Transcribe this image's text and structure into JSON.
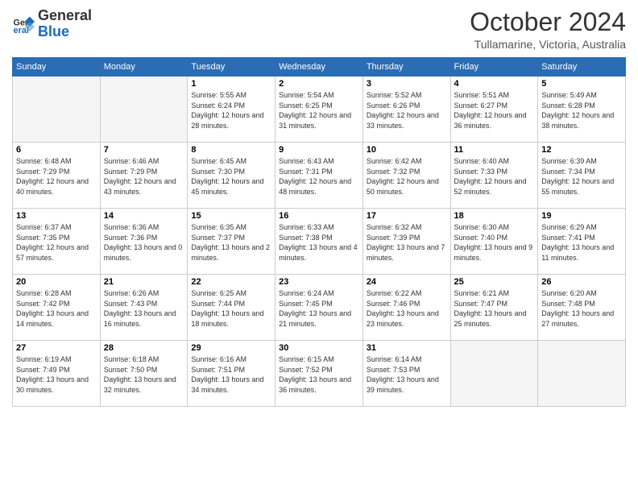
{
  "header": {
    "logo_general": "General",
    "logo_blue": "Blue",
    "month_title": "October 2024",
    "location": "Tullamarine, Victoria, Australia"
  },
  "days_of_week": [
    "Sunday",
    "Monday",
    "Tuesday",
    "Wednesday",
    "Thursday",
    "Friday",
    "Saturday"
  ],
  "weeks": [
    [
      {
        "day": "",
        "empty": true
      },
      {
        "day": "",
        "empty": true
      },
      {
        "day": "1",
        "sunrise": "5:55 AM",
        "sunset": "6:24 PM",
        "daylight": "12 hours and 28 minutes."
      },
      {
        "day": "2",
        "sunrise": "5:54 AM",
        "sunset": "6:25 PM",
        "daylight": "12 hours and 31 minutes."
      },
      {
        "day": "3",
        "sunrise": "5:52 AM",
        "sunset": "6:26 PM",
        "daylight": "12 hours and 33 minutes."
      },
      {
        "day": "4",
        "sunrise": "5:51 AM",
        "sunset": "6:27 PM",
        "daylight": "12 hours and 36 minutes."
      },
      {
        "day": "5",
        "sunrise": "5:49 AM",
        "sunset": "6:28 PM",
        "daylight": "12 hours and 38 minutes."
      }
    ],
    [
      {
        "day": "6",
        "sunrise": "6:48 AM",
        "sunset": "7:29 PM",
        "daylight": "12 hours and 40 minutes."
      },
      {
        "day": "7",
        "sunrise": "6:46 AM",
        "sunset": "7:29 PM",
        "daylight": "12 hours and 43 minutes."
      },
      {
        "day": "8",
        "sunrise": "6:45 AM",
        "sunset": "7:30 PM",
        "daylight": "12 hours and 45 minutes."
      },
      {
        "day": "9",
        "sunrise": "6:43 AM",
        "sunset": "7:31 PM",
        "daylight": "12 hours and 48 minutes."
      },
      {
        "day": "10",
        "sunrise": "6:42 AM",
        "sunset": "7:32 PM",
        "daylight": "12 hours and 50 minutes."
      },
      {
        "day": "11",
        "sunrise": "6:40 AM",
        "sunset": "7:33 PM",
        "daylight": "12 hours and 52 minutes."
      },
      {
        "day": "12",
        "sunrise": "6:39 AM",
        "sunset": "7:34 PM",
        "daylight": "12 hours and 55 minutes."
      }
    ],
    [
      {
        "day": "13",
        "sunrise": "6:37 AM",
        "sunset": "7:35 PM",
        "daylight": "12 hours and 57 minutes."
      },
      {
        "day": "14",
        "sunrise": "6:36 AM",
        "sunset": "7:36 PM",
        "daylight": "13 hours and 0 minutes."
      },
      {
        "day": "15",
        "sunrise": "6:35 AM",
        "sunset": "7:37 PM",
        "daylight": "13 hours and 2 minutes."
      },
      {
        "day": "16",
        "sunrise": "6:33 AM",
        "sunset": "7:38 PM",
        "daylight": "13 hours and 4 minutes."
      },
      {
        "day": "17",
        "sunrise": "6:32 AM",
        "sunset": "7:39 PM",
        "daylight": "13 hours and 7 minutes."
      },
      {
        "day": "18",
        "sunrise": "6:30 AM",
        "sunset": "7:40 PM",
        "daylight": "13 hours and 9 minutes."
      },
      {
        "day": "19",
        "sunrise": "6:29 AM",
        "sunset": "7:41 PM",
        "daylight": "13 hours and 11 minutes."
      }
    ],
    [
      {
        "day": "20",
        "sunrise": "6:28 AM",
        "sunset": "7:42 PM",
        "daylight": "13 hours and 14 minutes."
      },
      {
        "day": "21",
        "sunrise": "6:26 AM",
        "sunset": "7:43 PM",
        "daylight": "13 hours and 16 minutes."
      },
      {
        "day": "22",
        "sunrise": "6:25 AM",
        "sunset": "7:44 PM",
        "daylight": "13 hours and 18 minutes."
      },
      {
        "day": "23",
        "sunrise": "6:24 AM",
        "sunset": "7:45 PM",
        "daylight": "13 hours and 21 minutes."
      },
      {
        "day": "24",
        "sunrise": "6:22 AM",
        "sunset": "7:46 PM",
        "daylight": "13 hours and 23 minutes."
      },
      {
        "day": "25",
        "sunrise": "6:21 AM",
        "sunset": "7:47 PM",
        "daylight": "13 hours and 25 minutes."
      },
      {
        "day": "26",
        "sunrise": "6:20 AM",
        "sunset": "7:48 PM",
        "daylight": "13 hours and 27 minutes."
      }
    ],
    [
      {
        "day": "27",
        "sunrise": "6:19 AM",
        "sunset": "7:49 PM",
        "daylight": "13 hours and 30 minutes."
      },
      {
        "day": "28",
        "sunrise": "6:18 AM",
        "sunset": "7:50 PM",
        "daylight": "13 hours and 32 minutes."
      },
      {
        "day": "29",
        "sunrise": "6:16 AM",
        "sunset": "7:51 PM",
        "daylight": "13 hours and 34 minutes."
      },
      {
        "day": "30",
        "sunrise": "6:15 AM",
        "sunset": "7:52 PM",
        "daylight": "13 hours and 36 minutes."
      },
      {
        "day": "31",
        "sunrise": "6:14 AM",
        "sunset": "7:53 PM",
        "daylight": "13 hours and 39 minutes."
      },
      {
        "day": "",
        "empty": true
      },
      {
        "day": "",
        "empty": true
      }
    ]
  ],
  "labels": {
    "sunrise": "Sunrise:",
    "sunset": "Sunset:",
    "daylight": "Daylight:"
  }
}
